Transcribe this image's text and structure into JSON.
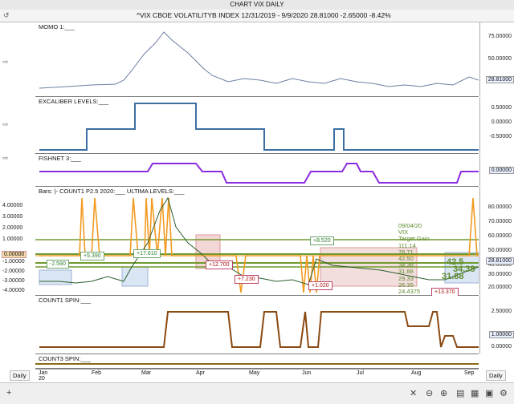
{
  "window": {
    "title": "CHART VIX DAILY"
  },
  "header": {
    "text": "^VIX   CBOE VOLATILITYB INDEX     12/31/2019 - 9/9/2020     28.81000   -2.65000   -8.42%"
  },
  "panels": {
    "momo": {
      "label": "MOMO 1:___",
      "ticks": [
        "75.00000",
        "50.00000",
        "28.81000"
      ]
    },
    "excaliber": {
      "label": "EXCALIBER LEVELS:___",
      "ticks": [
        "0.50000",
        "0.00000",
        "-0.50000"
      ]
    },
    "fishnet": {
      "label": "FISHNET 3:___",
      "ticks": [
        "0.00000"
      ]
    },
    "bars": {
      "label": "Bars: |-    COUNT1 P2.5 2020:___   ULTIMA LEVELS:___",
      "left_ticks": [
        "4.00000",
        "3.00000",
        "2.00000",
        "1.00000",
        "0.00000",
        "-1.00000",
        "-2.00000",
        "-3.00000",
        "-4.00000"
      ],
      "right_ticks": [
        "80.00000",
        "70.00000",
        "60.00000",
        "50.00000",
        "40.00000",
        "30.00000",
        "28.81000",
        "20.00000"
      ],
      "callouts": [
        "-2.590",
        "+5.390",
        "+17.610",
        "+12.700",
        "+7.230",
        "+8.520",
        "+1.020",
        "+13.370"
      ],
      "annotation": [
        "09/04/20",
        "VIX",
        "Target Gain",
        "111.14",
        "78.71",
        "42.50",
        "34.38",
        "31.88",
        "29.33",
        "26.35",
        "24.4375"
      ],
      "big_levels": [
        "42.5",
        "34.38",
        "31.88"
      ]
    },
    "count1": {
      "label": "COUNT1 SPIN:___",
      "ticks": [
        "2.50000",
        "1.00000",
        "0.00000"
      ]
    },
    "count3": {
      "label": "COUNT3 SPIN:___"
    }
  },
  "xaxis": {
    "months": [
      "Jan",
      "Feb",
      "Mar",
      "Apr",
      "May",
      "Jun",
      "Jul",
      "Aug",
      "Sep"
    ],
    "year": "20"
  },
  "controls": {
    "daily_left": "Daily",
    "daily_right": "Daily",
    "add": "+"
  },
  "colors": {
    "orange": "#f39a21",
    "blue": "#3e6fa3",
    "purple": "#8a2be2",
    "green": "#6f9a2f",
    "brown": "#8a4a12",
    "red": "#b33"
  }
}
